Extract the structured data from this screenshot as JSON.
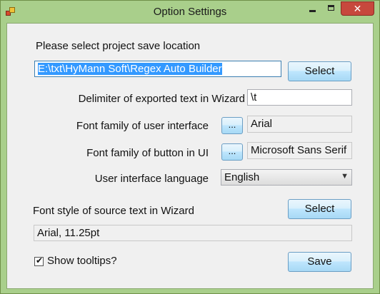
{
  "window": {
    "title": "Option Settings",
    "icon": "app-icon",
    "controls": {
      "minimize": "minimize-icon",
      "maximize": "maximize-icon",
      "close_glyph": "✕"
    }
  },
  "save_location": {
    "label": "Please select project save location",
    "path": "E:\\txt\\HyMann Soft\\Regex Auto Builder",
    "select_button": "Select"
  },
  "delimiter": {
    "label": "Delimiter of exported text in Wizard",
    "value": "\\t"
  },
  "ui_font": {
    "label": "Font family of user interface",
    "browse_button": "...",
    "value": "Arial"
  },
  "button_font": {
    "label": "Font family of button in UI",
    "browse_button": "...",
    "value": "Microsoft Sans Serif"
  },
  "language": {
    "label": "User interface language",
    "selected": "English"
  },
  "source_font": {
    "label": "Font style of source text in Wizard",
    "select_button": "Select",
    "value": "Arial, 11.25pt"
  },
  "tooltips": {
    "label": "Show tooltips?",
    "checked": true
  },
  "save_button": "Save"
}
